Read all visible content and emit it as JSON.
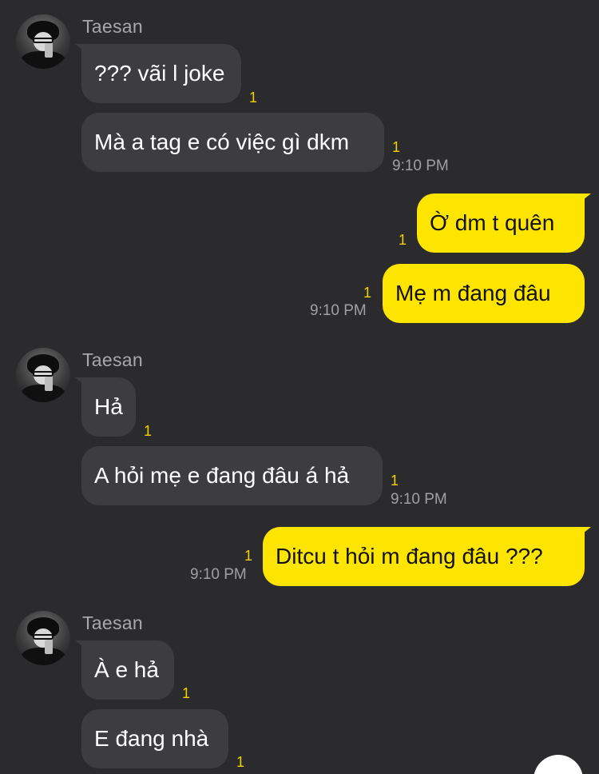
{
  "colors": {
    "background": "#2b2b2d",
    "incoming_bubble": "#3d3d3f",
    "outgoing_bubble": "#fee500",
    "unread_indicator": "#f2d200"
  },
  "groups": [
    {
      "sender": "Taesan",
      "messages": [
        {
          "text": "??? vãi l joke",
          "unread": "1"
        },
        {
          "text": "Mà a tag e có việc gì dkm",
          "unread": "1",
          "time": "9:10 PM"
        }
      ]
    },
    {
      "sender": "me",
      "messages": [
        {
          "text": "Ờ dm t quên",
          "unread": "1"
        },
        {
          "text": "Mẹ m đang đâu",
          "unread": "1",
          "time": "9:10 PM"
        }
      ]
    },
    {
      "sender": "Taesan",
      "messages": [
        {
          "text": "Hả",
          "unread": "1"
        },
        {
          "text": "A hỏi mẹ e đang đâu á hả",
          "unread": "1",
          "time": "9:10 PM"
        }
      ]
    },
    {
      "sender": "me",
      "messages": [
        {
          "text": "Ditcu t hỏi m đang đâu ???",
          "unread": "1",
          "time": "9:10 PM"
        }
      ]
    },
    {
      "sender": "Taesan",
      "messages": [
        {
          "text": "À e hả",
          "unread": "1"
        },
        {
          "text": "E đang nhà",
          "unread": "1"
        }
      ]
    }
  ]
}
